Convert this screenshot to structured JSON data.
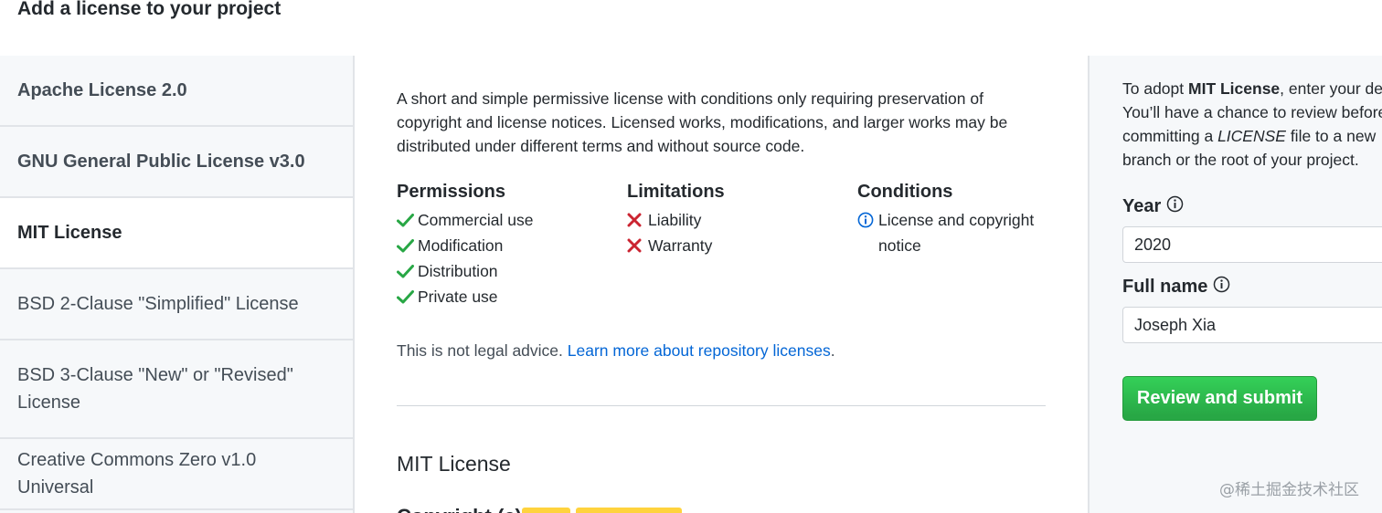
{
  "page": {
    "title": "Add a license to your project"
  },
  "sidebar": {
    "items": [
      {
        "label": "Apache License 2.0"
      },
      {
        "label": "GNU General Public License v3.0"
      },
      {
        "label": "MIT License"
      },
      {
        "label": "BSD 2-Clause \"Simplified\" License"
      },
      {
        "label": "BSD 3-Clause \"New\" or \"Revised\" License"
      },
      {
        "label": "Creative Commons Zero v1.0 Universal"
      }
    ],
    "selected": "MIT License"
  },
  "license": {
    "description": "A short and simple permissive license with conditions only requiring preservation of copyright and license notices. Licensed works, modifications, and larger works may be distributed under different terms and without source code.",
    "permissions": {
      "heading": "Permissions",
      "items": [
        "Commercial use",
        "Modification",
        "Distribution",
        "Private use"
      ]
    },
    "limitations": {
      "heading": "Limitations",
      "items": [
        "Liability",
        "Warranty"
      ]
    },
    "conditions": {
      "heading": "Conditions",
      "items": [
        "License and copyright notice"
      ]
    },
    "legal_text": "This is not legal advice.",
    "learn_more_link": "Learn more about repository licenses",
    "name": "MIT License",
    "copyright_partial": "Copyright (c)"
  },
  "adopt_panel": {
    "line1_prefix": "To adopt ",
    "line1_bold": "MIT License",
    "line1_suffix": ", enter your de",
    "line2": "You’ll have a chance to review before",
    "line3_prefix": "committing a ",
    "line3_italic": "LICENSE",
    "line3_suffix": " file to a new",
    "line4": "branch or the root of your project.",
    "year_label": "Year",
    "year_value": "2020",
    "fullname_label": "Full name",
    "fullname_value": "Joseph Xia",
    "submit_label": "Review and submit"
  },
  "colors": {
    "check": "#28a745",
    "cross": "#cb2431",
    "info": "#0366d6",
    "button": "#2ea44f"
  },
  "icons": {
    "permission": "check-icon",
    "limitation": "x-icon",
    "condition": "info-icon",
    "field_help": "info-icon"
  },
  "watermark": "@稀土掘金技术社区"
}
